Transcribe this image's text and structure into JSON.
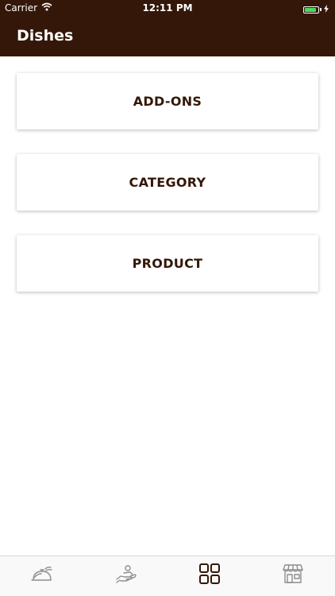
{
  "status_bar": {
    "carrier": "Carrier",
    "time": "12:11 PM",
    "battery_level": 0.85
  },
  "header": {
    "title": "Dishes",
    "background_color": "#341708"
  },
  "menu": {
    "items": [
      {
        "label": "ADD-ONS"
      },
      {
        "label": "CATEGORY"
      },
      {
        "label": "PRODUCT"
      }
    ]
  },
  "tab_bar": {
    "active_index": 2,
    "active_color": "#341708",
    "inactive_color": "#8e8e8e",
    "tabs": [
      {
        "icon": "food-tray-icon"
      },
      {
        "icon": "hand-serving-icon"
      },
      {
        "icon": "grid-icon"
      },
      {
        "icon": "store-icon"
      }
    ]
  }
}
